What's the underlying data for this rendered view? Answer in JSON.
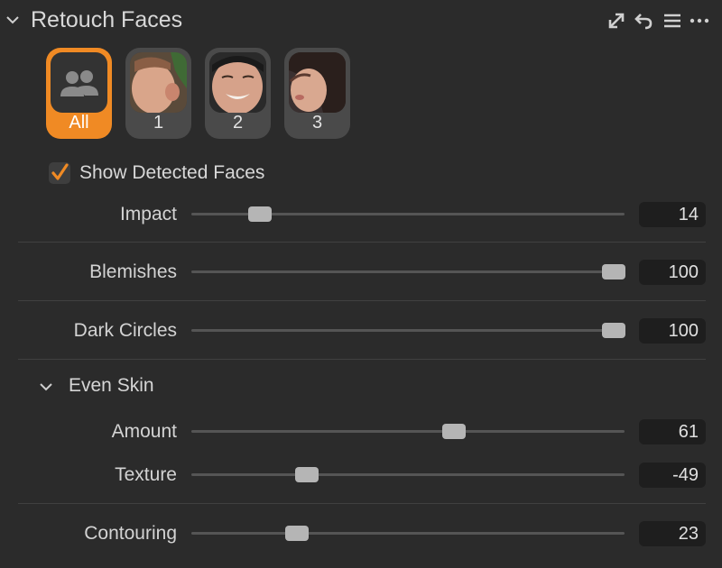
{
  "panel": {
    "title": "Retouch Faces",
    "header_icons": [
      "expand-icon",
      "reset-icon",
      "menu-icon",
      "more-icon"
    ]
  },
  "faces": [
    {
      "label": "All",
      "selected": true,
      "icon": "people-icon"
    },
    {
      "label": "1",
      "selected": false
    },
    {
      "label": "2",
      "selected": false
    },
    {
      "label": "3",
      "selected": false
    }
  ],
  "show_detected_faces": {
    "label": "Show Detected Faces",
    "checked": true
  },
  "sliders": {
    "impact": {
      "label": "Impact",
      "value": "14"
    },
    "blemishes": {
      "label": "Blemishes",
      "value": "100"
    },
    "dark_circles": {
      "label": "Dark Circles",
      "value": "100"
    },
    "amount": {
      "label": "Amount",
      "value": "61"
    },
    "texture": {
      "label": "Texture",
      "value": "-49"
    },
    "contouring": {
      "label": "Contouring",
      "value": "23"
    }
  },
  "even_skin": {
    "label": "Even Skin",
    "expanded": true
  },
  "colors": {
    "accent": "#f08a24",
    "background": "#2b2b2b",
    "value_box": "#1e1e1e"
  }
}
